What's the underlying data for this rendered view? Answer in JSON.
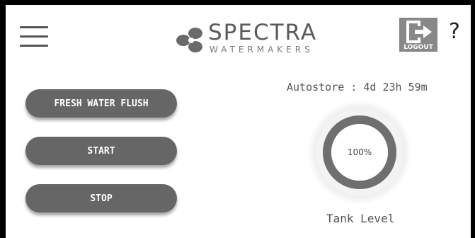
{
  "header": {
    "brand_name": "SPECTRA",
    "brand_sub": "WATERMAKERS",
    "logout_label": "LOGOUT",
    "help_label": "?",
    "menu_icon": "hamburger-menu-icon",
    "logout_icon": "logout-arrow-icon"
  },
  "controls": {
    "flush_label": "FRESH WATER FLUSH",
    "start_label": "START",
    "stop_label": "STOP"
  },
  "status": {
    "autostore_text": "Autostore : 4d 23h 59m",
    "tank_level_text": "100%",
    "tank_level_value": 100,
    "tank_label": "Tank Level"
  },
  "colors": {
    "button_bg": "#666666",
    "gauge_ring": "#6f6f6f",
    "logout_bg": "#888888"
  }
}
